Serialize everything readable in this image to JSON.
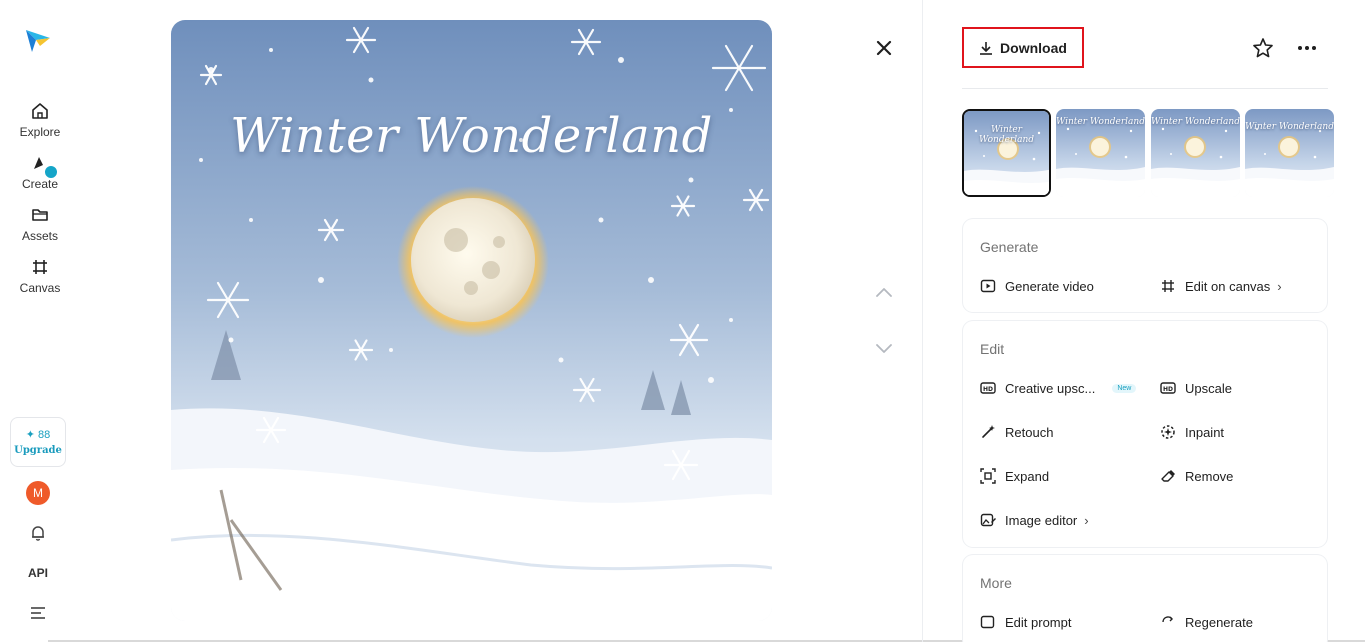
{
  "sidebar": {
    "logo_icon": "paper-plane-logo",
    "items": [
      {
        "label": "Explore",
        "icon": "home-icon"
      },
      {
        "label": "Create",
        "icon": "create-icon"
      },
      {
        "label": "Assets",
        "icon": "folder-icon"
      },
      {
        "label": "Canvas",
        "icon": "canvas-icon"
      }
    ],
    "credits": "✦ 88",
    "upgrade_label": "Upgrade",
    "avatar_initial": "M",
    "api_label": "API"
  },
  "image": {
    "title": "Winter Wonderland"
  },
  "toolbar": {
    "download_label": "Download"
  },
  "thumbnails": [
    {
      "title": "Winter Wonderland",
      "selected": true
    },
    {
      "title": "Winter Wonderland",
      "selected": false
    },
    {
      "title": "Winter Wonderland",
      "selected": false
    },
    {
      "title": "Winter Wonderland",
      "selected": false
    }
  ],
  "generate": {
    "title": "Generate",
    "actions": [
      {
        "label": "Generate video",
        "icon": "play-icon"
      },
      {
        "label": "Edit on canvas",
        "icon": "canvas-icon"
      }
    ]
  },
  "edit": {
    "title": "Edit",
    "new_tag": "New",
    "actions": [
      {
        "label": "Creative upsc...",
        "icon": "hd-plus-icon"
      },
      {
        "label": "Upscale",
        "icon": "hd-icon"
      },
      {
        "label": "Retouch",
        "icon": "magic-wand-icon"
      },
      {
        "label": "Inpaint",
        "icon": "inpaint-icon"
      },
      {
        "label": "Expand",
        "icon": "expand-icon"
      },
      {
        "label": "Remove",
        "icon": "eraser-icon"
      },
      {
        "label": "Image editor",
        "icon": "image-edit-icon"
      }
    ]
  },
  "more": {
    "title": "More",
    "actions": [
      {
        "label": "Edit prompt",
        "icon": "edit-icon"
      },
      {
        "label": "Regenerate",
        "icon": "regenerate-icon"
      }
    ]
  },
  "colors": {
    "accent": "#15a5c8",
    "highlight_border": "#e0141c",
    "avatar": "#ef5a2a"
  }
}
